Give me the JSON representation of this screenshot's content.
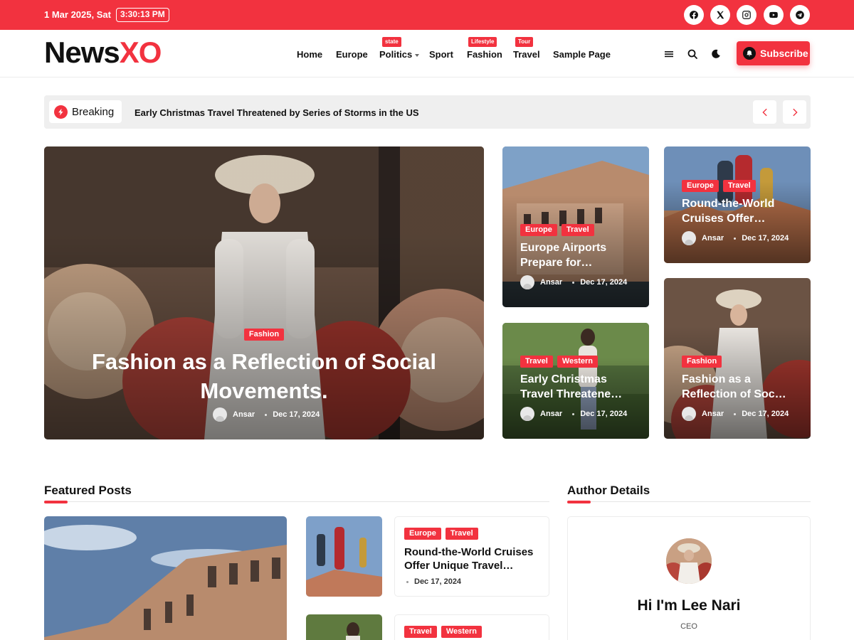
{
  "topbar": {
    "date": "1 Mar 2025, Sat",
    "time": "3:30:13 PM",
    "social": [
      "facebook-icon",
      "x-icon",
      "instagram-icon",
      "youtube-icon",
      "telegram-icon"
    ]
  },
  "header": {
    "logo_main": "News",
    "logo_accent": "XO",
    "nav": [
      {
        "label": "Home"
      },
      {
        "label": "Europe"
      },
      {
        "label": "Politics",
        "badge": "state"
      },
      {
        "label": "Sport"
      },
      {
        "label": "Fashion",
        "badge": "Lifestyle"
      },
      {
        "label": "Travel",
        "badge": "Tour"
      },
      {
        "label": "Sample Page"
      }
    ],
    "subscribe_label": "Subscribe"
  },
  "breaking": {
    "label": "Breaking",
    "headline": "Early Christmas Travel Threatened by Series of Storms in the US"
  },
  "hero": {
    "tag": "Fashion",
    "title_line1": "Fashion as a Reflection of Social",
    "title_line2": "Movements.",
    "author": "Ansar",
    "date": "Dec 17, 2024"
  },
  "grid_cards": [
    {
      "tags": [
        "Europe",
        "Travel"
      ],
      "title_line1": "Europe Airports",
      "title_line2": "Prepare for…",
      "author": "Ansar",
      "date": "Dec 17, 2024"
    },
    {
      "tags": [
        "Europe",
        "Travel"
      ],
      "title_line1": "Round-the-World",
      "title_line2": "Cruises Offer…",
      "author": "Ansar",
      "date": "Dec 17, 2024"
    },
    {
      "tags": [
        "Travel",
        "Western"
      ],
      "title_line1": "Early Christmas",
      "title_line2": "Travel Threatene…",
      "author": "Ansar",
      "date": "Dec 17, 2024"
    },
    {
      "tags": [
        "Fashion"
      ],
      "title_line1": "Fashion as a",
      "title_line2": "Reflection of Soc…",
      "author": "Ansar",
      "date": "Dec 17, 2024"
    }
  ],
  "featured": {
    "heading": "Featured Posts",
    "items": [
      {
        "tags": [
          "Europe",
          "Travel"
        ],
        "title_line1": "Round-the-World Cruises",
        "title_line2": "Offer Unique Travel…",
        "date": "Dec 17, 2024"
      },
      {
        "tags": [
          "Travel",
          "Western"
        ]
      }
    ]
  },
  "author_section": {
    "heading": "Author Details",
    "name": "Hi I'm Lee Nari",
    "role": "CEO"
  },
  "colors": {
    "accent": "#f2323f"
  }
}
